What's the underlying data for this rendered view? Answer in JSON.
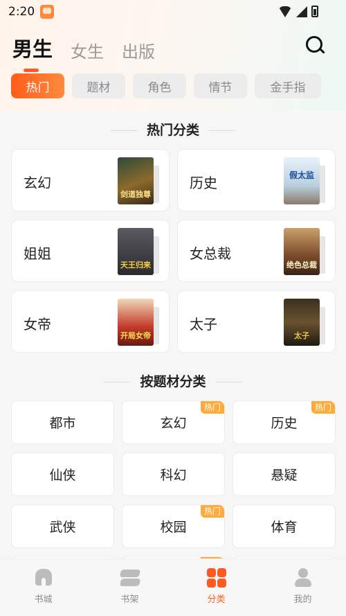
{
  "status_bar": {
    "time": "2:20"
  },
  "gender_tabs": [
    {
      "label": "男生",
      "active": true
    },
    {
      "label": "女生",
      "active": false
    },
    {
      "label": "出版",
      "active": false
    }
  ],
  "filter_chips": [
    {
      "label": "热门",
      "active": true
    },
    {
      "label": "题材",
      "active": false
    },
    {
      "label": "角色",
      "active": false
    },
    {
      "label": "情节",
      "active": false
    },
    {
      "label": "金手指",
      "active": false
    }
  ],
  "hot_section": {
    "title": "热门分类",
    "items": [
      {
        "label": "玄幻",
        "cover_title": "剑道独尊"
      },
      {
        "label": "历史",
        "cover_title": "假太监"
      },
      {
        "label": "姐姐",
        "cover_title": "天王归来"
      },
      {
        "label": "女总裁",
        "cover_title": "绝色总裁"
      },
      {
        "label": "女帝",
        "cover_title": "开局女帝"
      },
      {
        "label": "太子",
        "cover_title": "太子"
      }
    ]
  },
  "genre_section": {
    "title": "按题材分类",
    "hot_tag_text": "热门",
    "items": [
      {
        "label": "都市",
        "hot": false
      },
      {
        "label": "玄幻",
        "hot": true
      },
      {
        "label": "历史",
        "hot": true
      },
      {
        "label": "仙侠",
        "hot": false
      },
      {
        "label": "科幻",
        "hot": false
      },
      {
        "label": "悬疑",
        "hot": false
      },
      {
        "label": "武侠",
        "hot": false
      },
      {
        "label": "校园",
        "hot": true
      },
      {
        "label": "体育",
        "hot": false
      }
    ]
  },
  "bottom_nav": [
    {
      "label": "书城",
      "icon": "home-icon",
      "active": false
    },
    {
      "label": "书架",
      "icon": "bookshelf-icon",
      "active": false
    },
    {
      "label": "分类",
      "icon": "category-icon",
      "active": true
    },
    {
      "label": "我的",
      "icon": "profile-icon",
      "active": false
    }
  ],
  "colors": {
    "accent": "#ff5a1f",
    "hot_tag": "#ffaa3a",
    "chip_inactive": "#ececec"
  }
}
